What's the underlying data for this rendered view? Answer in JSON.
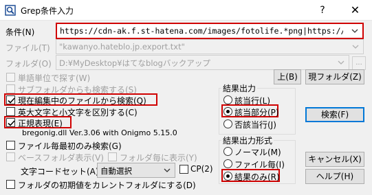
{
  "window": {
    "title": "Grep条件入力",
    "help_glyph": "?",
    "close_glyph": "✕"
  },
  "condition": {
    "label": "条件(N)",
    "value": "https://cdn-ak.f.st-hatena.com/images/fotolife.*png|https://cdn-ak.f.st"
  },
  "file": {
    "label": "ファイル(T)",
    "value": "\"kawanyo.hateblo.jp.export.txt\""
  },
  "folder": {
    "label": "フォルダ(O)",
    "value": "D:¥MyDesktop¥はてなblogバックアップ",
    "browse_label": "..."
  },
  "options": {
    "word_unit": "単語単位で探す(W)",
    "subfolder": "サブフォルダからも検索する(S)",
    "current_file": "現在編集中のファイルから検索(Q)",
    "case": "英大文字と小文字を区別する(C)",
    "regex": "正規表現(E)",
    "regex_lib": "bregonig.dll Ver.3.06 with Onigmo 5.15.0",
    "first_only": "ファイル毎最初のみ検索(G)",
    "base_folder": "ベースフォルダ表示(V)",
    "per_folder": "フォルダ毎に表示(Y)",
    "charset_label": "文字コードセット(A)",
    "charset_value": "自動選択",
    "cp_label": "CP(2)",
    "init_folder": "フォルダの初期値をカレントフォルダにする(D)"
  },
  "buttons": {
    "up": "上(B)",
    "current_folder": "現フォルダ(Z)",
    "search": "検索(F)",
    "cancel": "キャンセル(X)",
    "help": "ヘルプ(H)"
  },
  "result_output": {
    "title": "結果出力",
    "options": [
      "該当行(L)",
      "該当部分(P)",
      "否該当行(J)"
    ],
    "selected": "該当部分(P)"
  },
  "result_format": {
    "title": "結果出力形式",
    "options": [
      "ノーマル(M)",
      "ファイル毎(I)",
      "結果のみ(R)"
    ],
    "selected": "結果のみ(R)"
  },
  "colors": {
    "highlight": "#d00000",
    "default_button_border": "#0078d7"
  }
}
